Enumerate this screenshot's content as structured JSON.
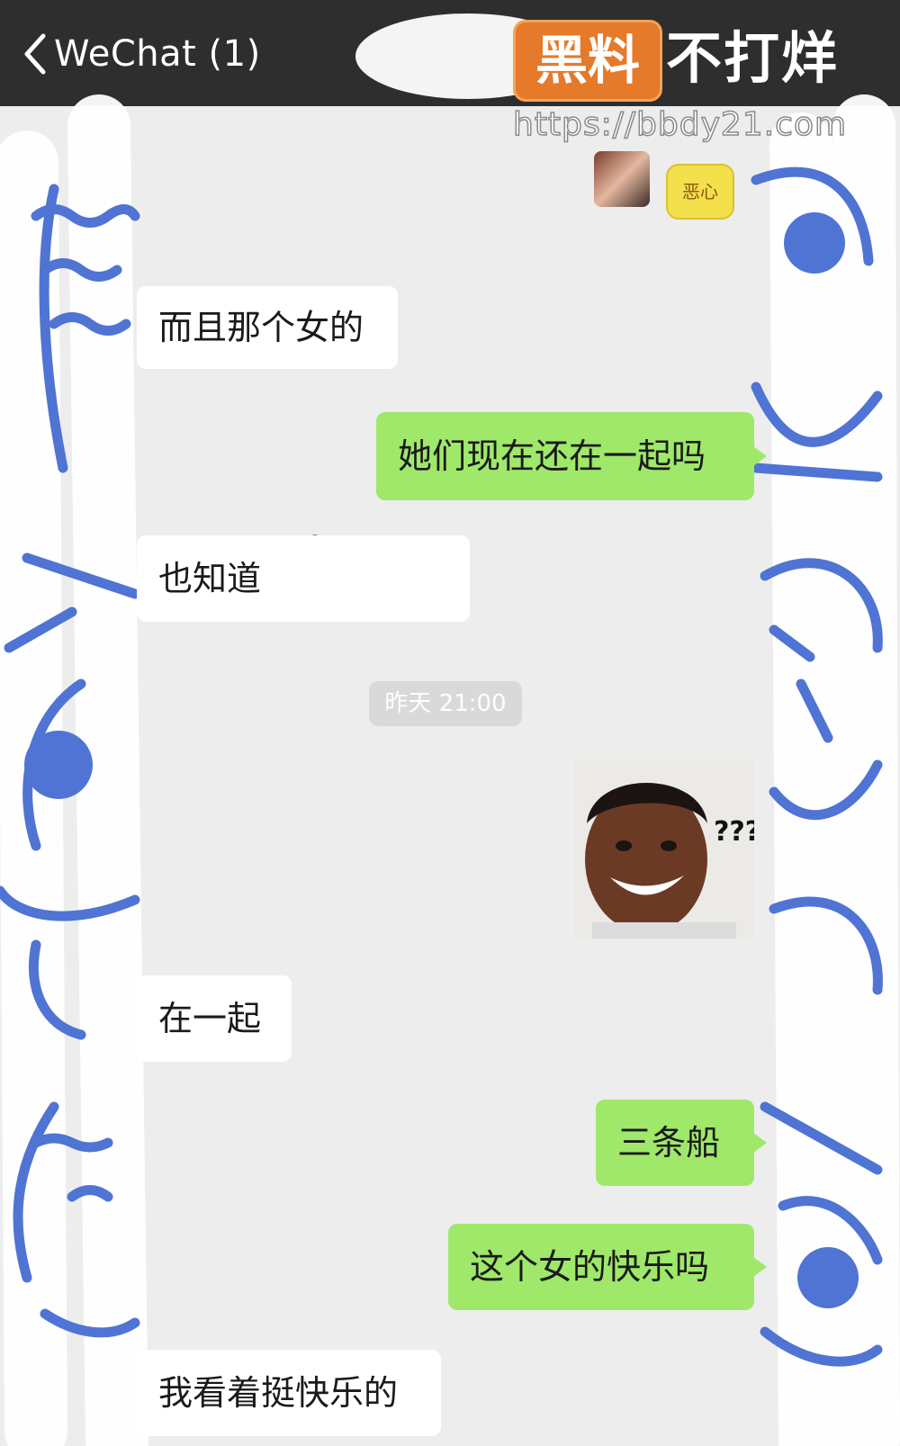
{
  "header": {
    "back_label": "WeChat (1)"
  },
  "watermark": {
    "badge": "黑料",
    "slogan": "不打烊",
    "url": "https://bbdy21.com"
  },
  "messages": [
    {
      "side": "out",
      "type": "sticker",
      "text": "恶心"
    },
    {
      "side": "in",
      "text": "而且那个女的"
    },
    {
      "side": "out",
      "text": "她们现在还在一起吗"
    },
    {
      "side": "in",
      "text": "也知道"
    },
    {
      "type": "time",
      "text": "昨天 21:00"
    },
    {
      "side": "out",
      "type": "image",
      "text": "???"
    },
    {
      "side": "in",
      "text": "在一起"
    },
    {
      "side": "out",
      "text": "三条船"
    },
    {
      "side": "out",
      "text": "这个女的快乐吗"
    },
    {
      "side": "in",
      "text": "我看着挺快乐的"
    }
  ],
  "colors": {
    "header_bg": "#2e2e2e",
    "chat_bg": "#ededed",
    "bubble_out": "#9fe86a",
    "bubble_in": "#ffffff",
    "doodle": "#4f74d4",
    "watermark_badge": "#e57a2a"
  }
}
